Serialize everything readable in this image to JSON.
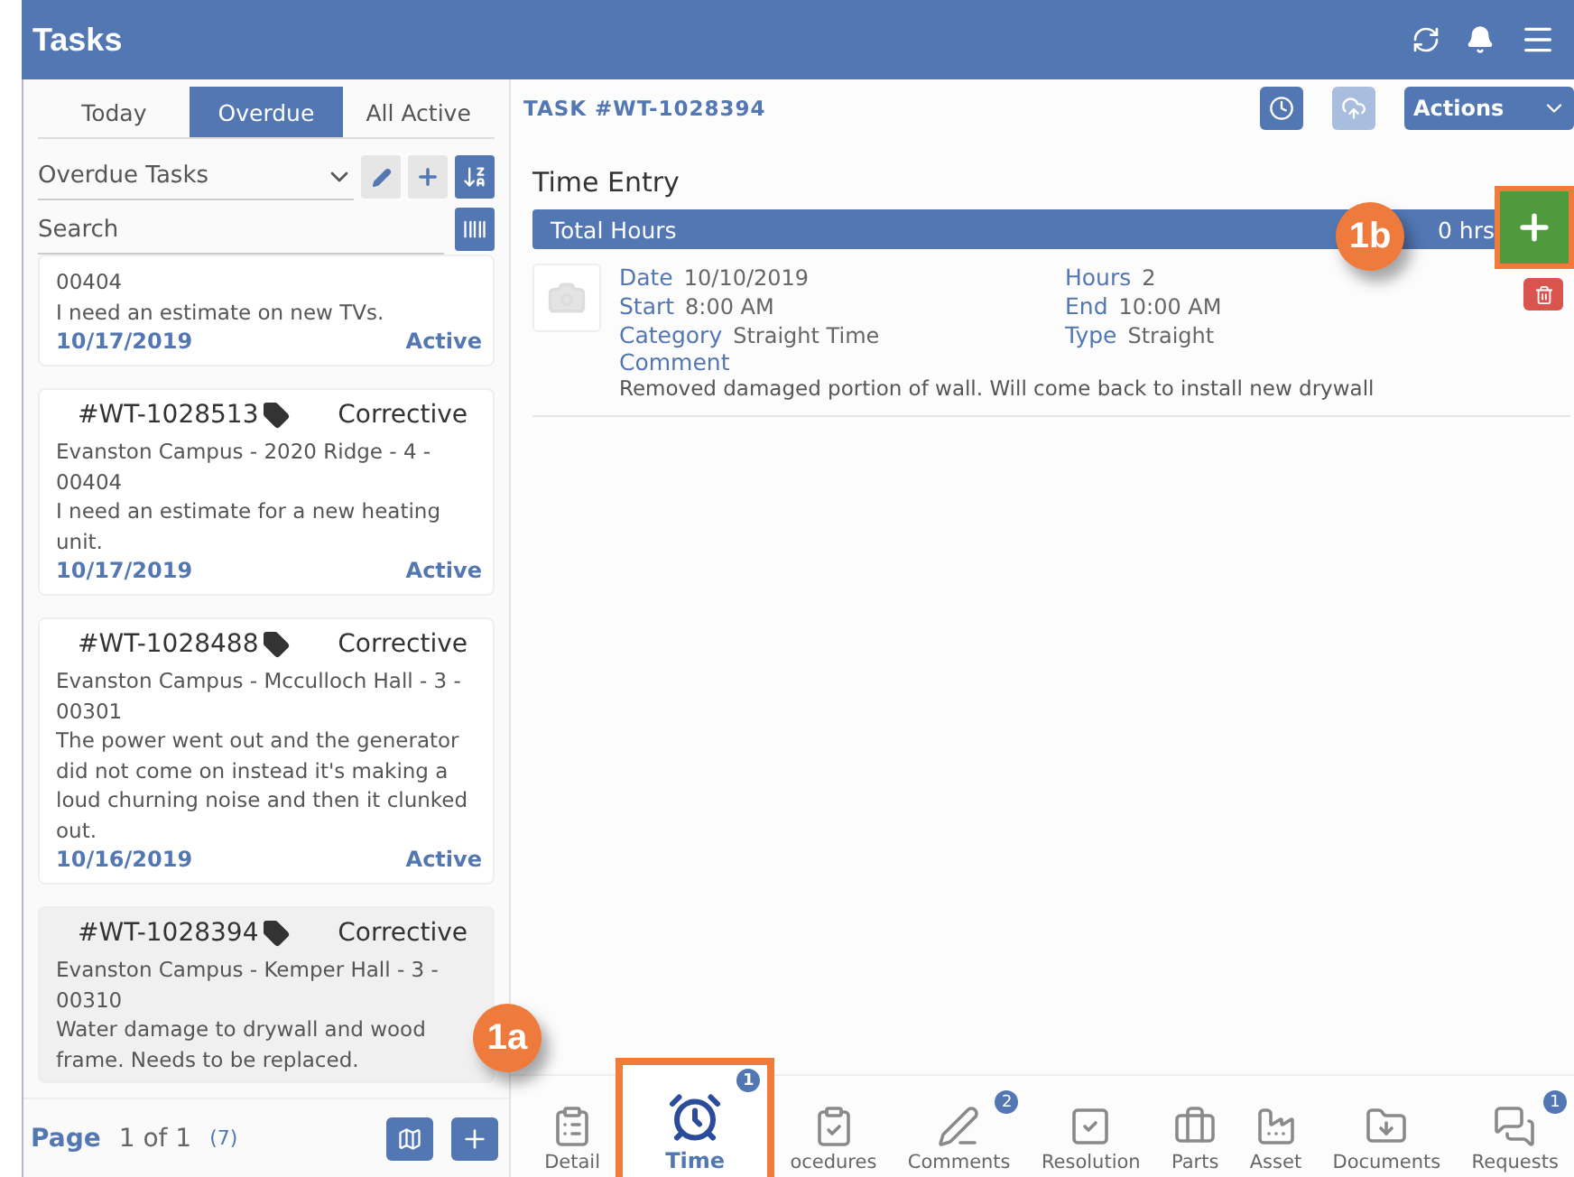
{
  "header": {
    "title": "Tasks"
  },
  "list_tabs": [
    {
      "label": "Today",
      "selected": false
    },
    {
      "label": "Overdue",
      "selected": true
    },
    {
      "label": "All Active",
      "selected": false
    }
  ],
  "filter": {
    "value": "Overdue Tasks"
  },
  "search": {
    "placeholder": "Search"
  },
  "tasks": [
    {
      "location": "00404",
      "description": "I need an estimate on new TVs.",
      "date": "10/17/2019",
      "status": "Active",
      "selected": false
    },
    {
      "id": "#WT-1028513",
      "type": "Corrective",
      "location": "Evanston Campus - 2020 Ridge - 4 - 00404",
      "description": "I need an estimate for a new heating unit.",
      "date": "10/17/2019",
      "status": "Active",
      "selected": false
    },
    {
      "id": "#WT-1028488",
      "type": "Corrective",
      "location": "Evanston Campus - Mcculloch Hall - 3 - 00301",
      "description": "The power went out and the generator did not come on instead it's making a loud churning noise and then it clunked out.",
      "date": "10/16/2019",
      "status": "Active",
      "selected": false
    },
    {
      "id": "#WT-1028394",
      "type": "Corrective",
      "location": "Evanston Campus - Kemper Hall - 3 - 00310",
      "description": "Water damage to drywall and wood frame. Needs to be replaced.",
      "selected": true
    }
  ],
  "pager": {
    "label": "Page",
    "pages": "1 of 1",
    "count": "(7)"
  },
  "task_title": "TASK #WT-1028394",
  "actions_button": "Actions",
  "section_title": "Time Entry",
  "total": {
    "label": "Total Hours",
    "value": "0 hrs"
  },
  "entry": {
    "fields": [
      {
        "label": "Date",
        "value": "10/10/2019"
      },
      {
        "label": "Hours",
        "value": "2"
      },
      {
        "label": "Start",
        "value": "8:00 AM"
      },
      {
        "label": "End",
        "value": "10:00 AM"
      },
      {
        "label": "Category",
        "value": "Straight Time"
      },
      {
        "label": "Type",
        "value": "Straight"
      }
    ],
    "comment_label": "Comment",
    "comment": "Removed damaged portion of wall. Will come back to install new drywall"
  },
  "nav": [
    {
      "kind": "detail",
      "label": "Detail",
      "selected": false
    },
    {
      "kind": "time",
      "label": "Time",
      "selected": true,
      "badge": "1"
    },
    {
      "kind": "procedures",
      "label": "ocedures",
      "selected": false
    },
    {
      "kind": "comments",
      "label": "Comments",
      "selected": false,
      "badge": "2"
    },
    {
      "kind": "resolution",
      "label": "Resolution",
      "selected": false
    },
    {
      "kind": "parts",
      "label": "Parts",
      "selected": false
    },
    {
      "kind": "asset",
      "label": "Asset",
      "selected": false
    },
    {
      "kind": "documents",
      "label": "Documents",
      "selected": false
    },
    {
      "kind": "requests",
      "label": "Requests",
      "selected": false,
      "badge": "1"
    }
  ],
  "callouts": [
    {
      "kind": "nav",
      "label": "1a"
    },
    {
      "kind": "add",
      "label": "1b"
    }
  ]
}
